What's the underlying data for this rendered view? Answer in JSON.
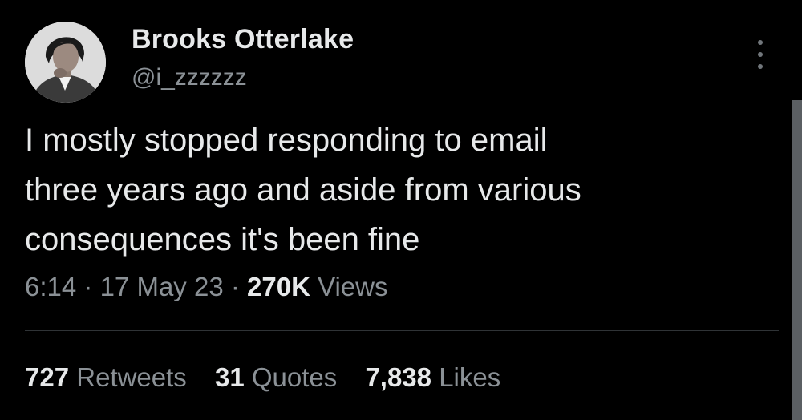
{
  "author": {
    "name": "Brooks Otterlake",
    "handle": "@i_zzzzzz"
  },
  "tweet": {
    "lines": [
      "I mostly stopped responding to email",
      "three years ago and aside from various",
      "consequences it's been fine"
    ],
    "time": "6:14",
    "date": "17 May 23",
    "separator": "·",
    "views_count": "270K",
    "views_label": "Views"
  },
  "stats": {
    "retweets_count": "727",
    "retweets_label": "Retweets",
    "quotes_count": "31",
    "quotes_label": "Quotes",
    "likes_count": "7,838",
    "likes_label": "Likes"
  },
  "colors": {
    "background": "#000000",
    "primary_text": "#e7e9ea",
    "secondary_text": "#8b9196",
    "divider": "#2f3336"
  },
  "icons": {
    "more": "more-options-icon"
  }
}
